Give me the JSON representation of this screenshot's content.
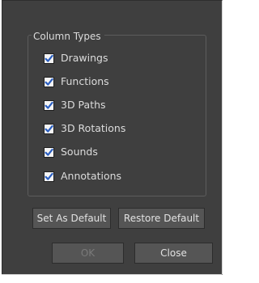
{
  "column_types": {
    "title": "Column Types",
    "items": [
      {
        "label": "Drawings",
        "checked": true
      },
      {
        "label": "Functions",
        "checked": true
      },
      {
        "label": "3D Paths",
        "checked": true
      },
      {
        "label": "3D Rotations",
        "checked": true
      },
      {
        "label": "Sounds",
        "checked": true
      },
      {
        "label": "Annotations",
        "checked": true
      }
    ]
  },
  "buttons": {
    "set_default": "Set As Default",
    "restore_default": "Restore Default",
    "ok": "OK",
    "ok_enabled": false,
    "close": "Close"
  },
  "colors": {
    "dialog_bg": "#3f3f3f",
    "button_bg": "#555555",
    "checkmark": "#2b5fc1",
    "text": "#dcdcdc"
  }
}
